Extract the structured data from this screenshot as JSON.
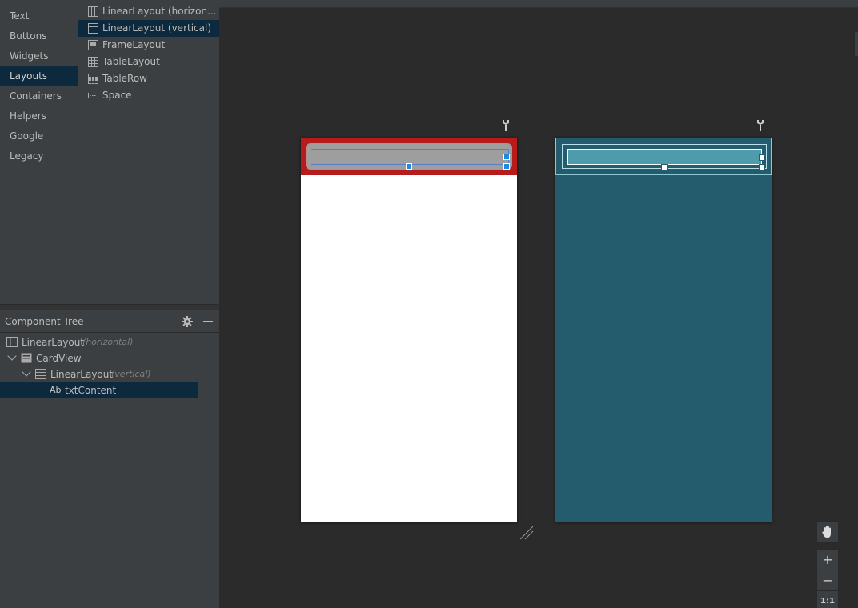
{
  "palette": {
    "categories": [
      {
        "label": "Text"
      },
      {
        "label": "Buttons"
      },
      {
        "label": "Widgets"
      },
      {
        "label": "Layouts",
        "active": true
      },
      {
        "label": "Containers"
      },
      {
        "label": "Helpers"
      },
      {
        "label": "Google"
      },
      {
        "label": "Legacy"
      }
    ],
    "components": [
      {
        "label": "LinearLayout (horizon...",
        "icon": "linear-horizontal-icon"
      },
      {
        "label": "LinearLayout (vertical)",
        "icon": "linear-vertical-icon",
        "active": true
      },
      {
        "label": "FrameLayout",
        "icon": "frame-layout-icon"
      },
      {
        "label": "TableLayout",
        "icon": "table-layout-icon"
      },
      {
        "label": "TableRow",
        "icon": "table-row-icon"
      },
      {
        "label": "Space",
        "icon": "space-icon"
      }
    ]
  },
  "component_tree": {
    "title": "Component Tree",
    "rows": [
      {
        "label": "LinearLayout",
        "meta": "(horizontal)",
        "icon": "linear-horizontal-icon"
      },
      {
        "label": "CardView",
        "icon": "card-view-icon",
        "expanded": true
      },
      {
        "label": "LinearLayout",
        "meta": "(vertical)",
        "icon": "linear-vertical-icon",
        "expanded": true
      },
      {
        "label": "txtContent",
        "icon": "textview-icon",
        "icon_text": "Ab",
        "selected": true
      }
    ]
  },
  "zoom": {
    "pan_icon": "hand-icon",
    "zoom_in": "+",
    "zoom_out": "−",
    "actual_size": "1:1"
  },
  "colors": {
    "card_background": "#b71c1c",
    "blueprint": "#245c6e",
    "selection": "#0d293e"
  }
}
